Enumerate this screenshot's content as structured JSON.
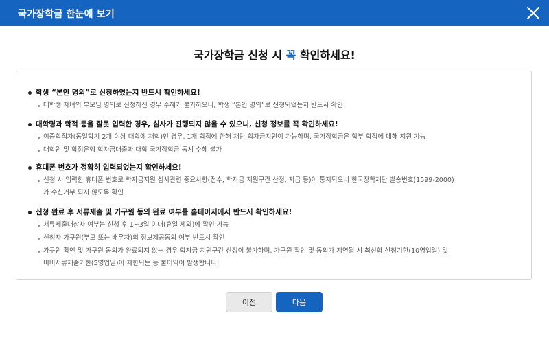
{
  "header": {
    "title": "국가장학금 한눈에 보기",
    "close_icon": "close-icon"
  },
  "headline": {
    "prefix": "국가장학금 신청 시 ",
    "highlight": "꼭",
    "suffix": " 확인하세요!"
  },
  "colors": {
    "header_bg": "#1565c0",
    "accent": "#1565c0",
    "prev_button_bg": "#e9e9e9"
  },
  "sections": [
    {
      "title": "학생 “본인 명의”로 신청하였는지 반드시 확인하세요!",
      "items": [
        {
          "text": "대학생 자녀의 부모님 명의로 신청하신 경우 수혜가 불가하오니, 학생 “본인 명의”로 신청되었는지 반드시 확인"
        }
      ]
    },
    {
      "title": "대학명과 학적 등을 잘못 입력한 경우, 심사가 진행되지 않을 수 있으니, 신청 정보를 꼭 확인하세요!",
      "items": [
        {
          "text": "이중학적자(동일학기 2개 이상 대학에 재학)인 경우, 1개 학적에 한해 재단 학자금지원이 가능하며, 국가장학금은 학부 학적에 대해 지원 가능"
        },
        {
          "text": "대학원 및 학점은행 학자금대출과 대학 국가장학금 동시 수혜 불가"
        }
      ]
    },
    {
      "title": "휴대폰 번호가 정확히 입력되었는지 확인하세요!",
      "items": [
        {
          "text": "신청 시 입력한 휴대폰 번호로 학자금지원 심사관련 중요사항(접수, 학자금 지원구간 산정, 지급 등)이 통지되오니 한국장학재단 발송번호(1599-2000)",
          "cont": "가 수신거부 되지 않도록 확인"
        }
      ]
    },
    {
      "title": "신청 완료 후 서류제출 및 가구원 동의 완료 여부를 홈페이지에서 반드시 확인하세요!",
      "items": [
        {
          "text": "서류제출대상자 여부는 신청 후 1~3일 이내(휴일 제외)에 확인 가능"
        },
        {
          "text": "신청자 가구원(부모 또는 배우자)의 정보제공동의 여부 반드시 확인"
        },
        {
          "text": "가구원 확인 및 가구원 동의가 완료되지 않는 경우 학자금 지원구간 산정이 불가하며, 가구원 확인 및 동의가 지연될 시 최신화 신청기한(10영업일) 및",
          "cont": "미비서류제출기한(5영업일)이 제한되는 등 불이익이 발생합니다!"
        }
      ]
    }
  ],
  "buttons": {
    "prev": "이전",
    "next": "다음"
  }
}
